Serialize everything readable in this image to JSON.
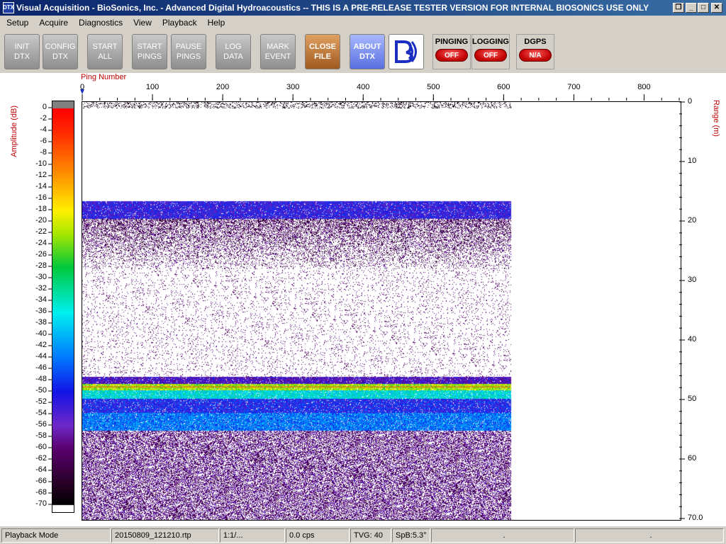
{
  "window": {
    "icon_text": "DTX",
    "title": "Visual Acquisition  -  BioSonics, Inc.  -  Advanced Digital Hydroacoustics  -- THIS IS A PRE-RELEASE TESTER VERSION FOR INTERNAL BIOSONICS USE ONLY",
    "restore_glyph": "❐",
    "minimize_glyph": "_",
    "maximize_glyph": "□",
    "close_glyph": "✕"
  },
  "menu": [
    "Setup",
    "Acquire",
    "Diagnostics",
    "View",
    "Playback",
    "Help"
  ],
  "toolbar": {
    "buttons": [
      {
        "label": "INIT\nDTX"
      },
      {
        "label": "CONFIG\nDTX"
      },
      {
        "label": "START\nALL"
      },
      {
        "label": "START\nPINGS"
      },
      {
        "label": "PAUSE\nPINGS"
      },
      {
        "label": "LOG\nDATA"
      },
      {
        "label": "MARK\nEVENT"
      },
      {
        "label": "CLOSE\nFILE"
      },
      {
        "label": "ABOUT\nDTX"
      }
    ],
    "logo_icon": "biosonics-logo-icon",
    "status": [
      {
        "title": "PINGING",
        "value": "OFF"
      },
      {
        "title": "LOGGING",
        "value": "OFF"
      },
      {
        "title": "DGPS",
        "value": "N/A"
      }
    ]
  },
  "chart_data": {
    "type": "heatmap",
    "x_axis_label": "Ping Number",
    "x_ticks": [
      "0",
      "100",
      "200",
      "300",
      "400",
      "500",
      "600",
      "700",
      "800"
    ],
    "xlim": [
      0,
      850
    ],
    "y_axis_label": "Range (m)",
    "y_ticks": [
      "0",
      "10",
      "20",
      "30",
      "40",
      "50",
      "60",
      "70.0"
    ],
    "ylim": [
      0,
      70
    ],
    "colorbar_label": "Amplitude (dB)",
    "colorbar_ticks": [
      "0",
      "-2",
      "-4",
      "-6",
      "-8",
      "-10",
      "-12",
      "-14",
      "-16",
      "-18",
      "-20",
      "-22",
      "-24",
      "-26",
      "-28",
      "-30",
      "-32",
      "-34",
      "-36",
      "-38",
      "-40",
      "-42",
      "-44",
      "-46",
      "-48",
      "-50",
      "-52",
      "-54",
      "-56",
      "-58",
      "-60",
      "-62",
      "-64",
      "-66",
      "-68",
      "-70"
    ],
    "colorbar_range": [
      -70,
      0
    ],
    "pings_recorded": 610,
    "echo_layers": [
      {
        "range_m": [
          16.5,
          19.5
        ],
        "amplitude_db": -52
      },
      {
        "range_m": [
          19.5,
          28
        ],
        "amplitude_db": -62
      },
      {
        "range_m": [
          46.0,
          47.2
        ],
        "amplitude_db": -55
      },
      {
        "range_m": [
          47.2,
          48.2
        ],
        "amplitude_db": -22
      },
      {
        "range_m": [
          48.2,
          49.6
        ],
        "amplitude_db": -36
      },
      {
        "range_m": [
          49.6,
          52
        ],
        "amplitude_db": -50
      },
      {
        "range_m": [
          52,
          55
        ],
        "amplitude_db": -44
      },
      {
        "range_m": [
          55,
          70
        ],
        "amplitude_db": -60
      }
    ]
  },
  "statusbar": {
    "mode": "Playback Mode",
    "file": "20150809_121210.rtp",
    "ratio": "1:1/...",
    "cps": "0.0 cps",
    "tvg": "TVG: 40",
    "spb": "SpB:5.3°",
    "cell7": ".",
    "cell8": "."
  }
}
